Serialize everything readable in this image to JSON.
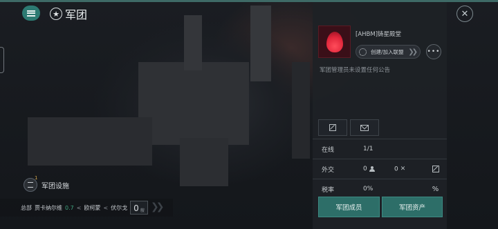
{
  "header": {
    "title": "军团"
  },
  "facility": {
    "label": "军团设施",
    "count": "1"
  },
  "location": {
    "hq_label": "总部",
    "system": "贾卡纳尔维",
    "security": "0.7",
    "separator": "<",
    "constellation": "欧柯蒙",
    "region": "伏尔戈",
    "docked_count": "0",
    "docked_unit": "艘"
  },
  "corp": {
    "name": "[AHBM]铸星殿堂",
    "join_button": "创建/加入联盟",
    "more_button": "•••",
    "notice": "军团管理员未设置任何公告"
  },
  "stats": {
    "online": {
      "label": "在线",
      "value": "1/1"
    },
    "diplomacy": {
      "label": "外交",
      "friendly": "0",
      "hostile": "0"
    },
    "tax": {
      "label": "税率",
      "value": "0%"
    }
  },
  "actions": {
    "members": "军团成员",
    "assets": "军团资产"
  },
  "colors": {
    "accent": "#2d7a72",
    "security_high": "#3fa37e",
    "emblem_red": "#e0253a"
  },
  "icons": {
    "menu": "menu-icon",
    "corp": "corporation-star-icon",
    "close": "close-icon",
    "edit": "edit-icon",
    "mail": "mail-icon",
    "members": "person-icon",
    "hostile": "crossed-swords-icon",
    "tax": "percent-icon"
  }
}
